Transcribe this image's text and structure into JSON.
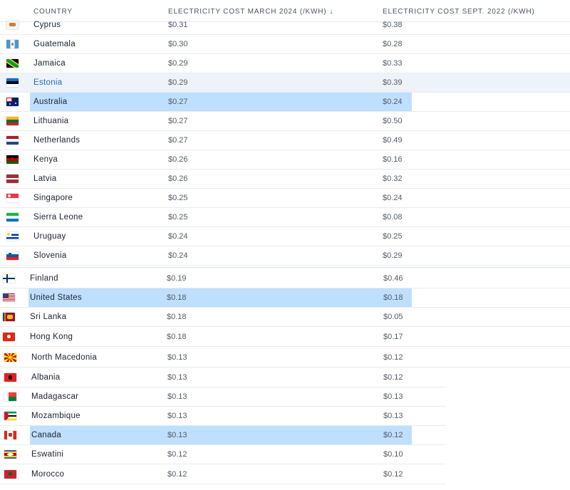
{
  "table": {
    "columns": [
      {
        "label": "COUNTRY"
      },
      {
        "label": "ELECTRICITY COST MARCH 2024 (/KWH)",
        "sort_icon": "↓",
        "sort_icon_name": "sort-desc-icon"
      },
      {
        "label": "ELECTRICITY COST SEPT. 2022 (/KWH)"
      }
    ],
    "rows": [
      {
        "country": "Cyprus",
        "march_2024": "$0.31",
        "sept_2022": "$0.38",
        "flag": "cyprus",
        "state": ""
      },
      {
        "country": "Guatemala",
        "march_2024": "$0.30",
        "sept_2022": "$0.28",
        "flag": "guatemala",
        "state": ""
      },
      {
        "country": "Jamaica",
        "march_2024": "$0.29",
        "sept_2022": "$0.33",
        "flag": "jamaica",
        "state": ""
      },
      {
        "country": "Estonia",
        "march_2024": "$0.29",
        "sept_2022": "$0.39",
        "flag": "estonia",
        "state": "hover"
      },
      {
        "country": "Australia",
        "march_2024": "$0.27",
        "sept_2022": "$0.24",
        "flag": "australia",
        "state": "highlighted"
      },
      {
        "country": "Lithuania",
        "march_2024": "$0.27",
        "sept_2022": "$0.50",
        "flag": "lithuania",
        "state": ""
      },
      {
        "country": "Netherlands",
        "march_2024": "$0.27",
        "sept_2022": "$0.49",
        "flag": "netherlands",
        "state": ""
      },
      {
        "country": "Kenya",
        "march_2024": "$0.26",
        "sept_2022": "$0.16",
        "flag": "kenya",
        "state": ""
      },
      {
        "country": "Latvia",
        "march_2024": "$0.26",
        "sept_2022": "$0.32",
        "flag": "latvia",
        "state": ""
      },
      {
        "country": "Singapore",
        "march_2024": "$0.25",
        "sept_2022": "$0.24",
        "flag": "singapore",
        "state": ""
      },
      {
        "country": "Sierra Leone",
        "march_2024": "$0.25",
        "sept_2022": "$0.08",
        "flag": "sierra-leone",
        "state": ""
      },
      {
        "country": "Uruguay",
        "march_2024": "$0.24",
        "sept_2022": "$0.25",
        "flag": "uruguay",
        "state": ""
      },
      {
        "country": "Slovenia",
        "march_2024": "$0.24",
        "sept_2022": "$0.29",
        "flag": "slovenia",
        "state": ""
      },
      {
        "country": "Finland",
        "march_2024": "$0.19",
        "sept_2022": "$0.46",
        "flag": "finland",
        "state": ""
      },
      {
        "country": "United States",
        "march_2024": "$0.18",
        "sept_2022": "$0.18",
        "flag": "united-states",
        "state": "highlighted"
      },
      {
        "country": "Sri Lanka",
        "march_2024": "$0.18",
        "sept_2022": "$0.05",
        "flag": "sri-lanka",
        "state": ""
      },
      {
        "country": "Hong Kong",
        "march_2024": "$0.18",
        "sept_2022": "$0.17",
        "flag": "hong-kong",
        "state": ""
      },
      {
        "country": "North Macedonia",
        "march_2024": "$0.13",
        "sept_2022": "$0.12",
        "flag": "north-macedonia",
        "state": ""
      },
      {
        "country": "Albania",
        "march_2024": "$0.13",
        "sept_2022": "$0.12",
        "flag": "albania",
        "state": ""
      },
      {
        "country": "Madagascar",
        "march_2024": "$0.13",
        "sept_2022": "$0.13",
        "flag": "madagascar",
        "state": ""
      },
      {
        "country": "Mozambique",
        "march_2024": "$0.13",
        "sept_2022": "$0.13",
        "flag": "mozambique",
        "state": ""
      },
      {
        "country": "Canada",
        "march_2024": "$0.13",
        "sept_2022": "$0.12",
        "flag": "canada",
        "state": "highlighted"
      },
      {
        "country": "Eswatini",
        "march_2024": "$0.12",
        "sept_2022": "$0.10",
        "flag": "eswatini",
        "state": ""
      },
      {
        "country": "Morocco",
        "march_2024": "$0.12",
        "sept_2022": "$0.12",
        "flag": "morocco",
        "state": ""
      }
    ]
  },
  "colors": {
    "highlight": "#bfdfff",
    "hover": "#eef3f9",
    "link": "#1c6cc7",
    "text": "#1a2230",
    "muted": "#535c66"
  }
}
